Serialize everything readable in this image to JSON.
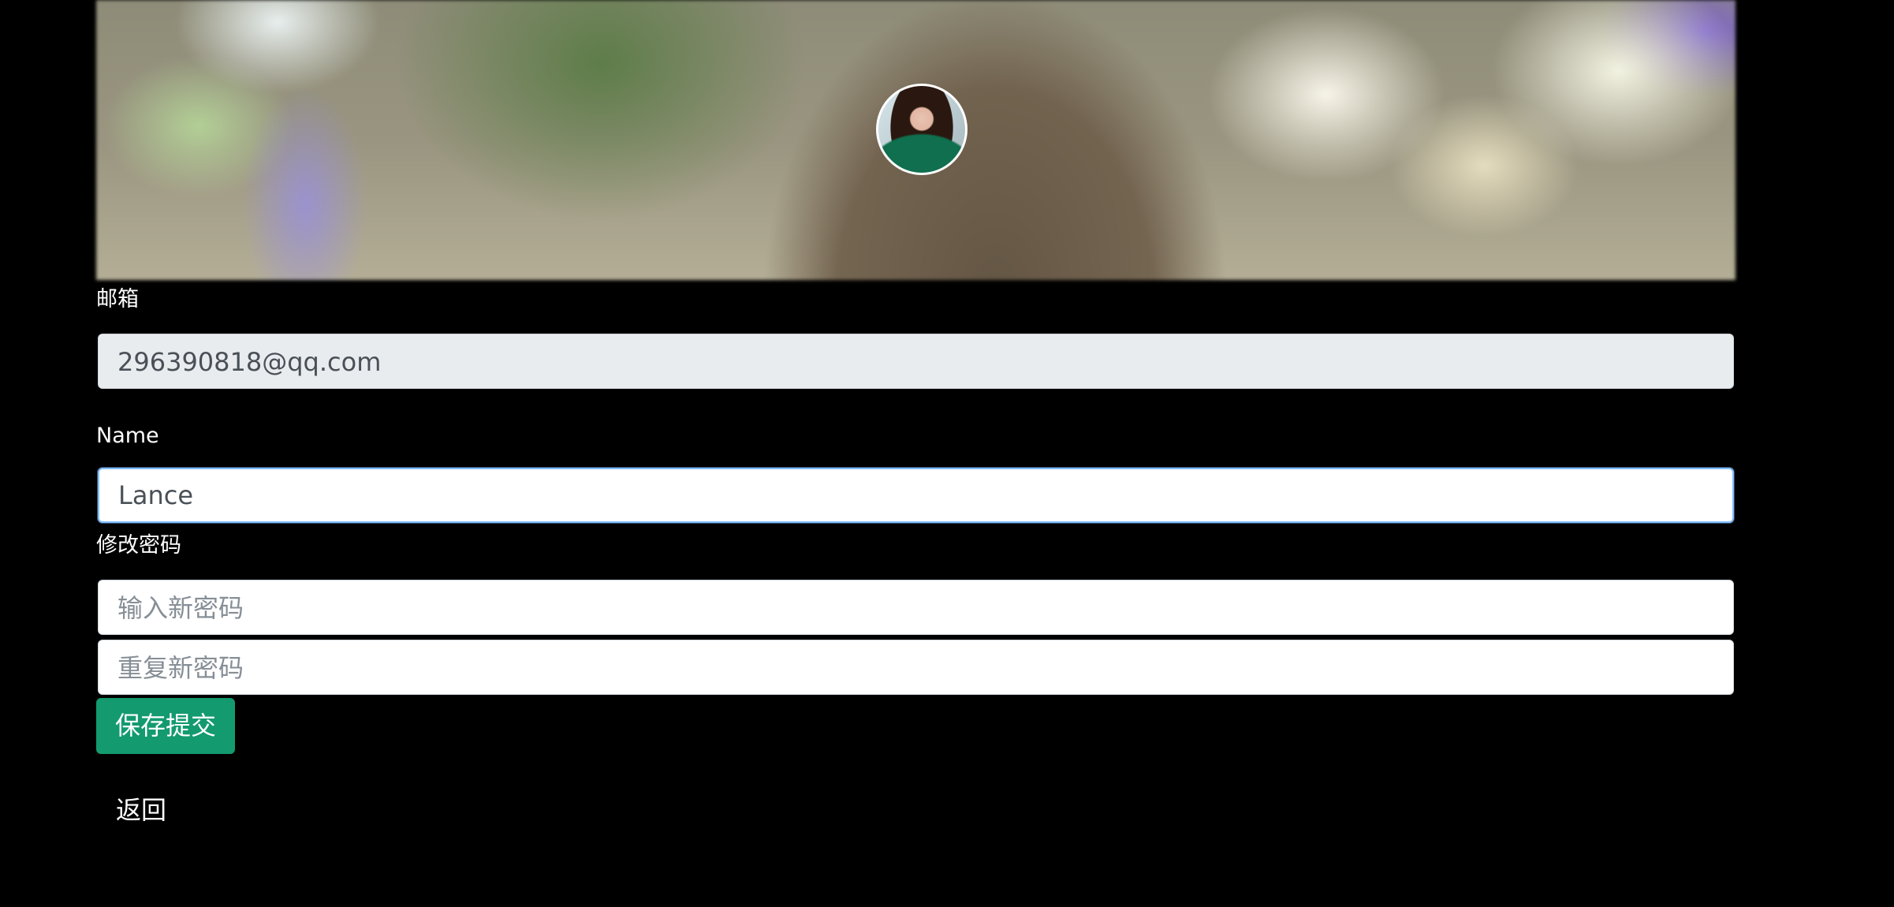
{
  "profile": {
    "cover_image": "blurred-bokeh-cover-photo",
    "avatar_image": "user-avatar-photo"
  },
  "form": {
    "email_label": "邮箱",
    "email_value": "296390818@qq.com",
    "name_label": "Name",
    "name_value": "Lance",
    "password_label": "修改密码",
    "new_password_placeholder": "输入新密码",
    "repeat_password_placeholder": "重复新密码",
    "save_label": "保存提交",
    "back_label": "返回"
  },
  "colors": {
    "background": "#000000",
    "save_button": "#139a6f",
    "readonly_field": "#e9ecef",
    "focus_border": "#80bdff"
  }
}
